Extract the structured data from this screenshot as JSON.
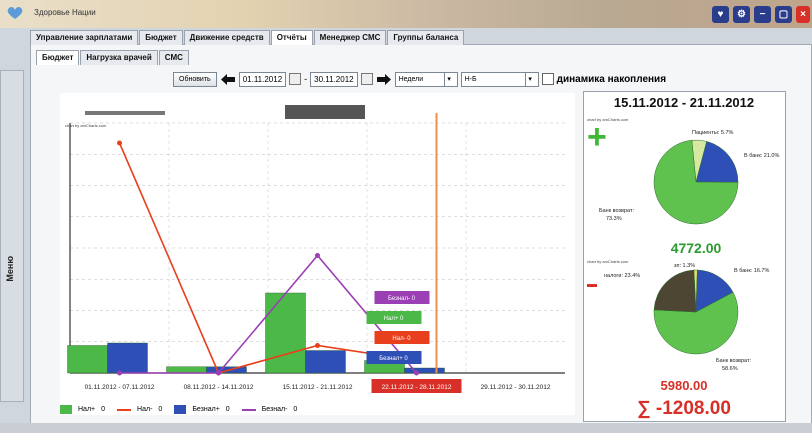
{
  "window": {
    "title": "Здоровье Нации"
  },
  "main_tabs": [
    "Управление зарплатами",
    "Бюджет",
    "Движение средств",
    "Отчёты",
    "Менеджер СМС",
    "Группы баланса"
  ],
  "active_main_tab": 3,
  "sub_tabs": [
    "Бюджет",
    "Нагрузка врачей",
    "СМС"
  ],
  "side_menu": {
    "label": "Меню"
  },
  "toolbar": {
    "refresh": "Обновить",
    "date_from": "01.11.2012",
    "date_to": "30.11.2012",
    "separator": "-",
    "period": "Недели",
    "group": "Н-Б",
    "accumulation_label": "динамика накопления"
  },
  "chart_data": [
    {
      "type": "bar",
      "credit": "chart by amCharts.com",
      "categories": [
        "01.11.2012 - 07.11.2012",
        "08.11.2012 - 14.11.2012",
        "15.11.2012 - 21.11.2012",
        "22.11.2012 - 28.11.2012",
        "29.11.2012 - 30.11.2012"
      ],
      "highlighted_category": "22.11.2012 - 28.11.2012",
      "series": [
        {
          "name": "Нал+",
          "kind": "bar",
          "color": "#4cb848",
          "values": [
            1100,
            250,
            3200,
            500,
            0
          ]
        },
        {
          "name": "Нал-",
          "kind": "line",
          "color": "#e8401c",
          "values": [
            9200,
            0,
            1100,
            500,
            0
          ]
        },
        {
          "name": "Безнал+",
          "kind": "bar",
          "color": "#2e4fb5",
          "values": [
            1200,
            250,
            900,
            200,
            0
          ]
        },
        {
          "name": "Безнал-",
          "kind": "line",
          "color": "#9b3fb5",
          "values": [
            0,
            0,
            4700,
            0,
            0
          ]
        }
      ],
      "legend_values": [
        "0",
        "0",
        "0",
        "0"
      ],
      "tooltips": [
        {
          "text": "Безнал- 0",
          "color": "#9b3fb5"
        },
        {
          "text": "Нал+ 0",
          "color": "#4cb848"
        },
        {
          "text": "Нал- 0",
          "color": "#e8401c"
        },
        {
          "text": "Безнал+ 0",
          "color": "#2e4fb5"
        }
      ]
    },
    {
      "type": "pie",
      "title": "15.11.2012 - 21.11.2012",
      "credit": "chart by amCharts.com",
      "slices": [
        {
          "label": "Банк возврат",
          "value": 73.3,
          "color": "#5fc24f"
        },
        {
          "label": "В банк",
          "value": 21.0,
          "color": "#2e4fb5"
        },
        {
          "label": "Пациенты",
          "value": 5.7,
          "color": "#d7e8a0"
        }
      ],
      "total": "4772.00",
      "total_color": "#2c9a30"
    },
    {
      "type": "pie",
      "credit": "chart by amCharts.com",
      "slices": [
        {
          "label": "Банк возврат",
          "value": 58.6,
          "color": "#5fc24f"
        },
        {
          "label": "налоги",
          "value": 23.4,
          "color": "#4c4632"
        },
        {
          "label": "В банк",
          "value": 16.7,
          "color": "#2e4fb5"
        },
        {
          "label": "зп",
          "value": 1.3,
          "color": "#e8e06a"
        }
      ],
      "total": "5980.00",
      "total_color": "#d83028"
    }
  ],
  "summary": {
    "symbol": "∑",
    "value": "-1208.00"
  },
  "labels": {
    "pie1_patients": "Пациенты: 5.7%",
    "pie1_bank": "В банк: 21.0%",
    "pie1_return": "Банк возврат:",
    "pie1_return_pct": "73.3%",
    "pie2_zp": "зп: 1.3%",
    "pie2_tax": "налоги: 23.4%",
    "pie2_bank": "В банк: 16.7%",
    "pie2_return": "Банк возврат:",
    "pie2_return_pct": "58.6%"
  }
}
